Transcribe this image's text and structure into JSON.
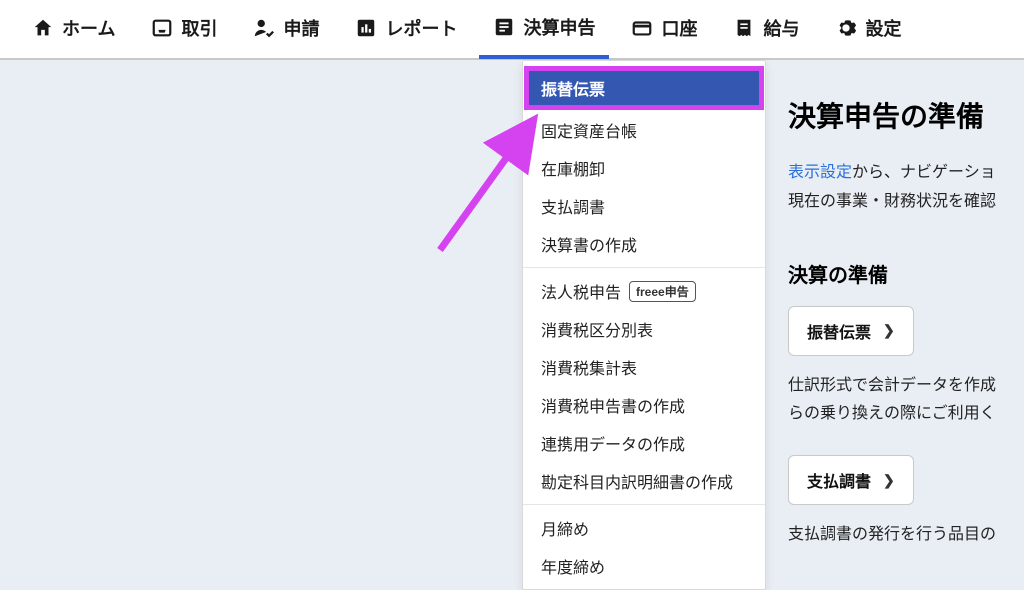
{
  "nav": {
    "items": [
      {
        "label": "ホーム",
        "icon": "home-icon"
      },
      {
        "label": "取引",
        "icon": "tray-icon"
      },
      {
        "label": "申請",
        "icon": "approve-icon"
      },
      {
        "label": "レポート",
        "icon": "report-icon"
      },
      {
        "label": "決算申告",
        "icon": "doc-icon",
        "active": true
      },
      {
        "label": "口座",
        "icon": "card-icon"
      },
      {
        "label": "給与",
        "icon": "receipt-icon"
      },
      {
        "label": "設定",
        "icon": "gear-icon"
      }
    ]
  },
  "dropdown": {
    "sections": [
      {
        "items": [
          {
            "label": "振替伝票",
            "highlighted": true
          },
          {
            "label": "固定資産台帳"
          },
          {
            "label": "在庫棚卸"
          },
          {
            "label": "支払調書"
          },
          {
            "label": "決算書の作成"
          }
        ]
      },
      {
        "items": [
          {
            "label": "法人税申告",
            "badge": "freee申告"
          },
          {
            "label": "消費税区分別表"
          },
          {
            "label": "消費税集計表"
          },
          {
            "label": "消費税申告書の作成"
          },
          {
            "label": "連携用データの作成"
          },
          {
            "label": "勘定科目内訳明細書の作成"
          }
        ]
      },
      {
        "items": [
          {
            "label": "月締め"
          },
          {
            "label": "年度締め"
          }
        ]
      }
    ]
  },
  "right": {
    "title": "決算申告の準備",
    "linkText": "表示設定",
    "paragraph1": "から、ナビゲーショ",
    "paragraph2": "現在の事業・財務状況を確認",
    "subheading": "決算の準備",
    "btn1": "振替伝票",
    "btn1Desc1": "仕訳形式で会計データを作成",
    "btn1Desc2": "らの乗り換えの際にご利用く",
    "btn2": "支払調書",
    "btn2Desc1": "支払調書の発行を行う品目の"
  }
}
